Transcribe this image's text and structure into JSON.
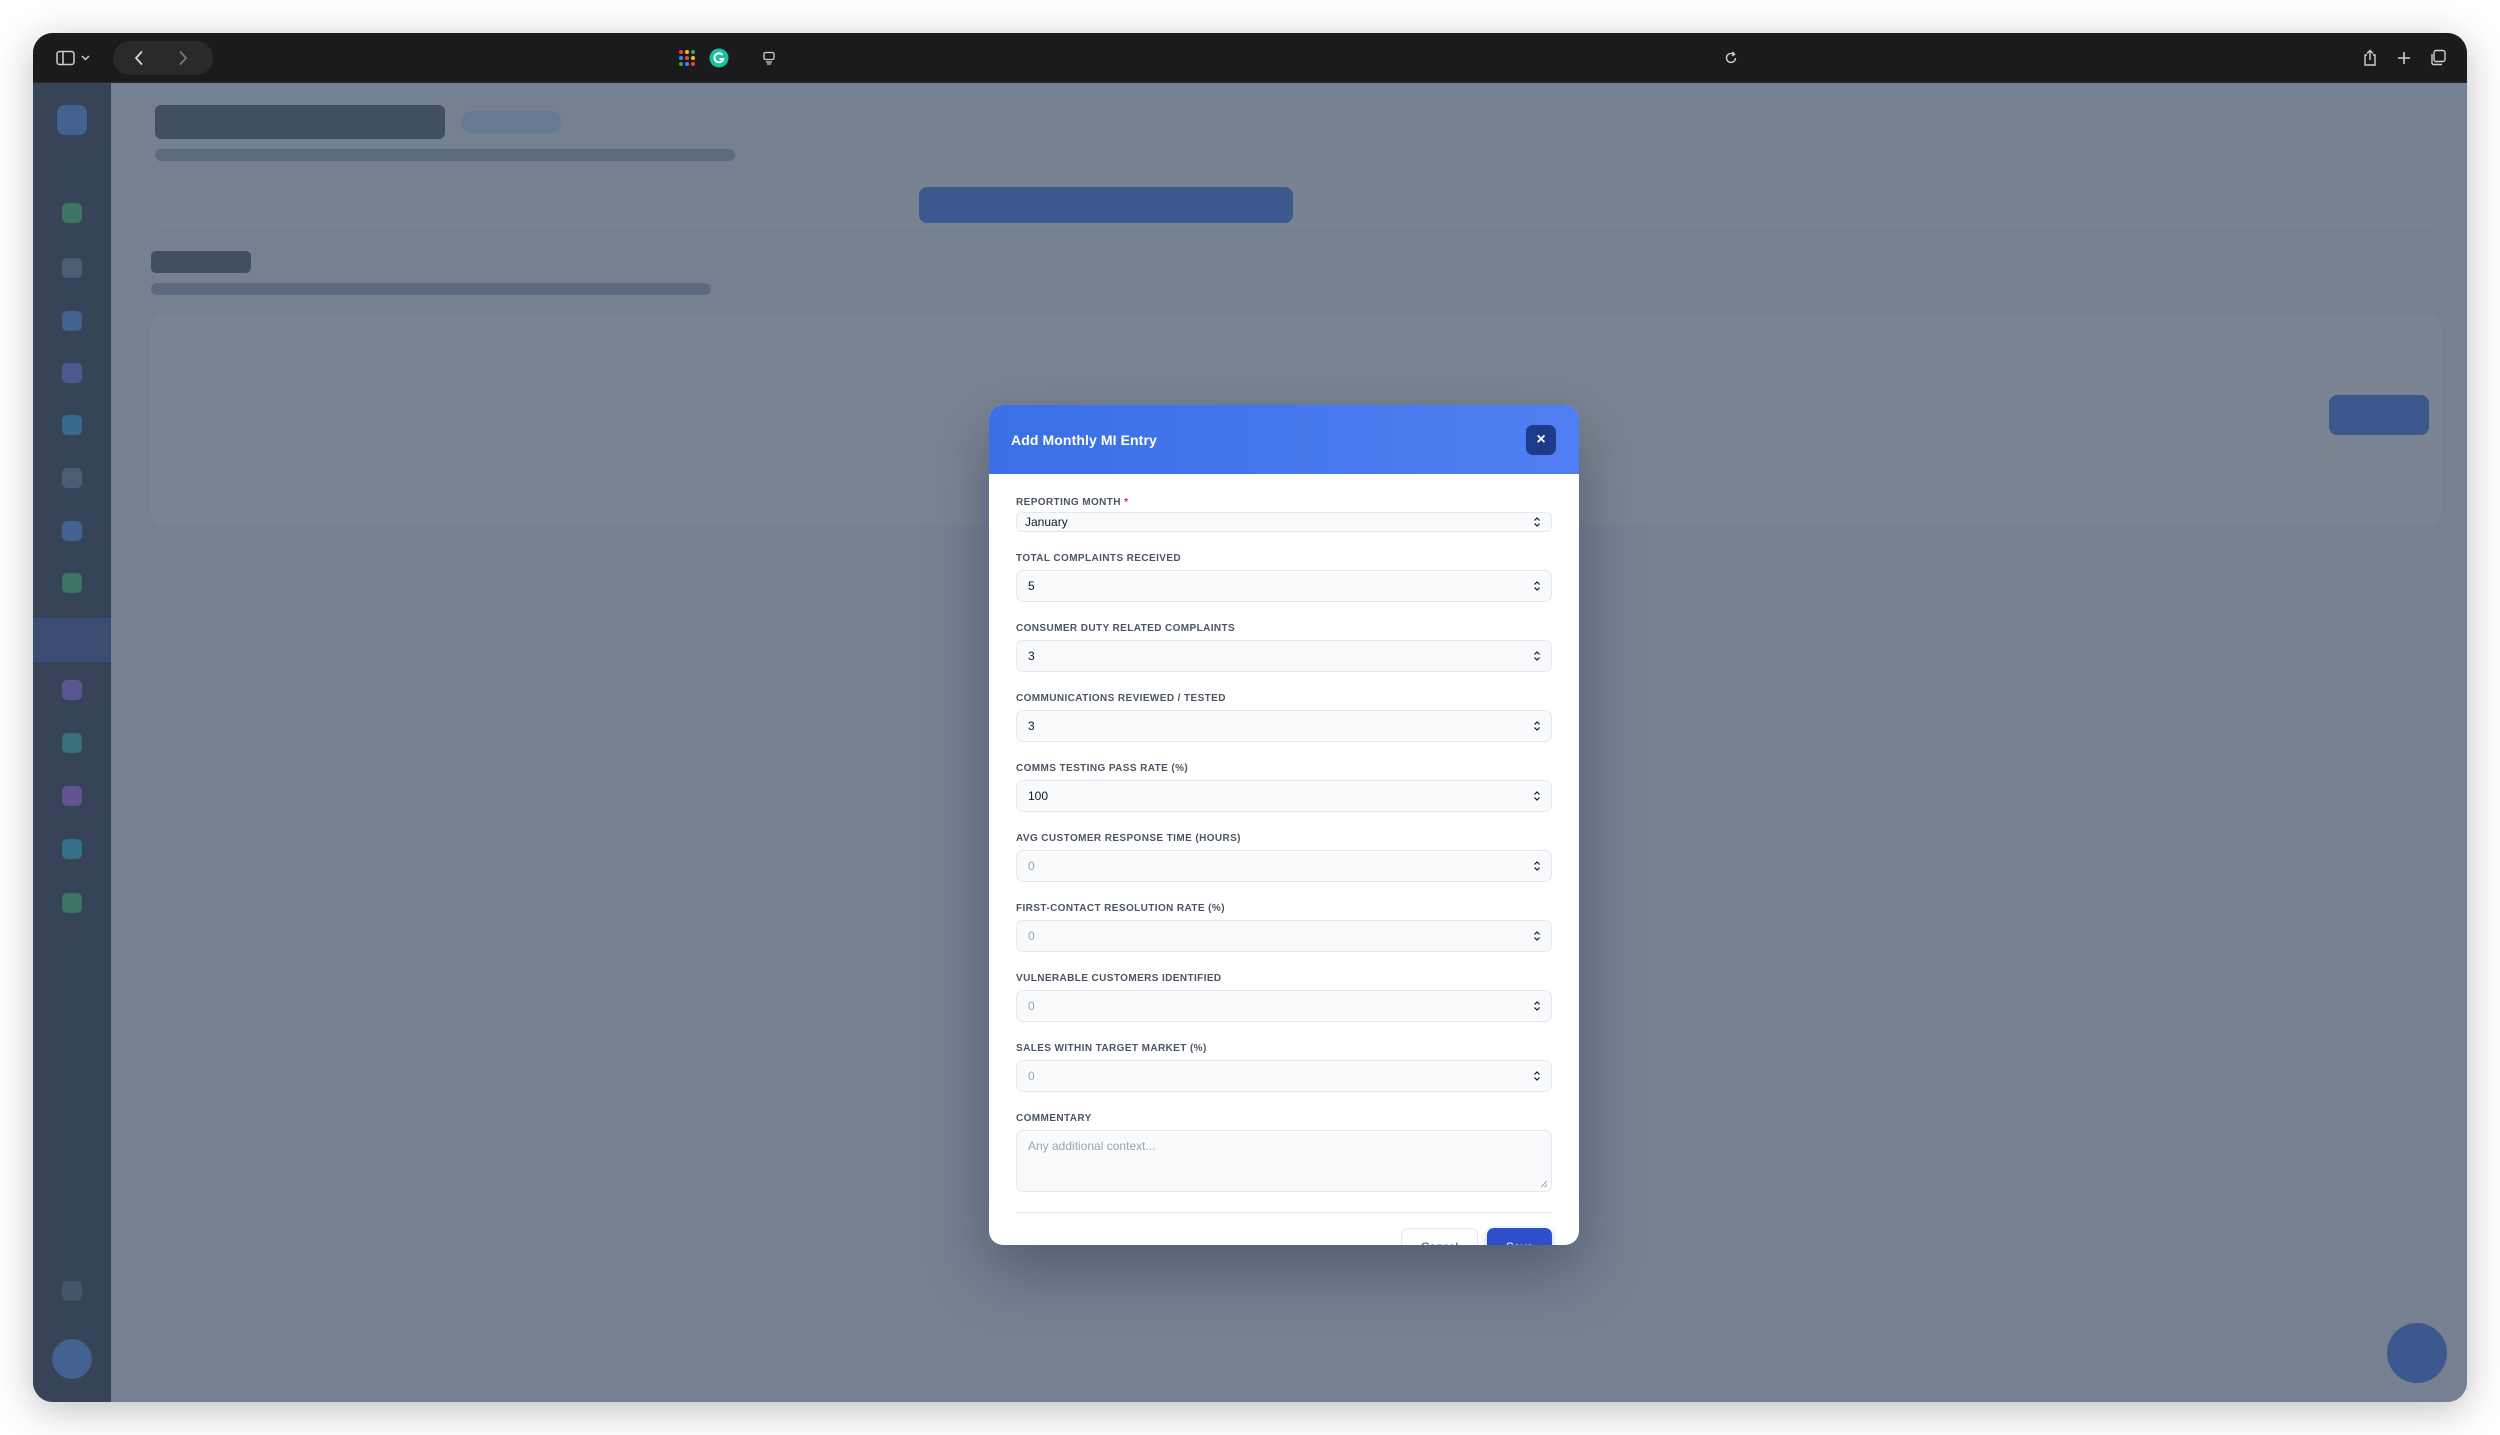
{
  "modal": {
    "title": "Add Monthly MI Entry",
    "close_label": "×",
    "reporting_month": {
      "label": "REPORTING MONTH",
      "required_mark": "*",
      "value": "January"
    },
    "fields": [
      {
        "label": "TOTAL COMPLAINTS RECEIVED",
        "value": "5",
        "placeholder": false
      },
      {
        "label": "CONSUMER DUTY RELATED COMPLAINTS",
        "value": "3",
        "placeholder": false
      },
      {
        "label": "COMMUNICATIONS REVIEWED / TESTED",
        "value": "3",
        "placeholder": false
      },
      {
        "label": "COMMS TESTING PASS RATE (%)",
        "value": "100",
        "placeholder": false
      },
      {
        "label": "AVG CUSTOMER RESPONSE TIME (HOURS)",
        "value": "0",
        "placeholder": true
      },
      {
        "label": "FIRST-CONTACT RESOLUTION RATE (%)",
        "value": "0",
        "placeholder": true
      },
      {
        "label": "VULNERABLE CUSTOMERS IDENTIFIED",
        "value": "0",
        "placeholder": true
      },
      {
        "label": "SALES WITHIN TARGET MARKET (%)",
        "value": "0",
        "placeholder": true
      }
    ],
    "commentary": {
      "label": "COMMENTARY",
      "placeholder": "Any additional context..."
    },
    "cancel_label": "Cancel",
    "save_label": "Save"
  },
  "colors": {
    "header_gradient_start": "#3b6fe6",
    "header_gradient_end": "#4f7ff2",
    "close_button": "#1e3a8a",
    "save_button": "#2f4fc9",
    "required": "#dc2626",
    "overlay": "#475569"
  },
  "icons": {
    "sidebar_toggle": "sidebar-icon",
    "back": "chevron-left-icon",
    "forward": "chevron-right-icon",
    "reload": "reload-icon",
    "share": "share-icon",
    "new_tab": "plus-icon",
    "tabs": "tabs-icon"
  }
}
